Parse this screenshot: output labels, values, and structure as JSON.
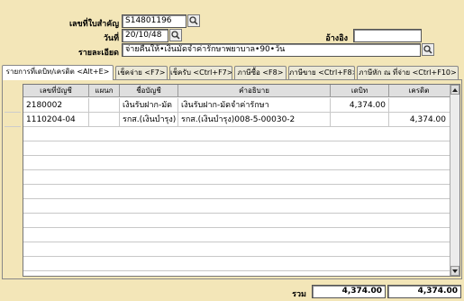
{
  "header": {
    "doc_no_label": "เลขที่ใบสำคัญ",
    "doc_no_value": "S14801196",
    "date_label": "วันที่",
    "date_value": "20/10/48",
    "ref_label": "อ้างอิง",
    "ref_value": "",
    "desc_label": "รายละเอียด",
    "desc_value": "จ่ายคืนให้•เงินมัดจำค่ารักษาพยาบาล•90•วัน"
  },
  "tabs": [
    {
      "label": "รายการที่เดบิท/เครดิต <Alt+E>",
      "active": true
    },
    {
      "label": "เช็คจ่าย <F7>",
      "active": false
    },
    {
      "label": "เช็ครับ <Ctrl+F7>",
      "active": false
    },
    {
      "label": "ภาษีซื้อ <F8>",
      "active": false
    },
    {
      "label": "ภาษีขาย <Ctrl+F8>",
      "active": false
    },
    {
      "label": "ภาษีหัก ณ ที่จ่าย <Ctrl+F10>",
      "active": false
    }
  ],
  "table": {
    "columns": [
      "เลขที่บัญชี",
      "แผนก",
      "ชื่อบัญชี",
      "คำอธิบาย",
      "เดบิท",
      "เครดิต"
    ],
    "rows": [
      {
        "account": "2180002",
        "dept": "",
        "name": "เงินรับฝาก-มัด",
        "desc": "เงินรับฝาก-มัดจำค่ารักษา",
        "debit": "4,374.00",
        "credit": ""
      },
      {
        "account": "1110204-04",
        "dept": "",
        "name": "รกส.(เงินบำรุง)",
        "desc": "รกส.(เงินบำรุง)008-5-00030-2",
        "debit": "",
        "credit": "4,374.00"
      }
    ]
  },
  "totals": {
    "label": "รวม",
    "debit": "4,374.00",
    "credit": "4,374.00"
  },
  "colors": {
    "background": "#f3e6b8",
    "field": "#ffffff"
  }
}
